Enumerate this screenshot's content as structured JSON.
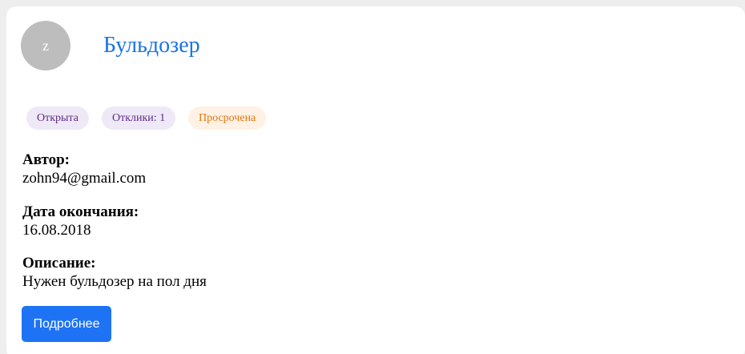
{
  "card": {
    "avatar_letter": "z",
    "title": "Бульдозер",
    "chips": {
      "status": "Открыта",
      "responses": "Отклики: 1",
      "overdue": "Просрочена"
    },
    "author": {
      "label": "Автор:",
      "value": "zohn94@gmail.com"
    },
    "end_date": {
      "label": "Дата окончания:",
      "value": "16.08.2018"
    },
    "description": {
      "label": "Описание:",
      "value": "Нужен бульдозер на пол дня"
    },
    "details_button": "Подробнее"
  },
  "colors": {
    "title": "#1a73e8",
    "button": "#1e73f5",
    "chip_purple_bg": "#efe8f6",
    "chip_purple_text": "#5b2d8a",
    "chip_orange_bg": "#fff1e3",
    "chip_orange_text": "#e07512",
    "avatar_bg": "#bdbdbd"
  }
}
